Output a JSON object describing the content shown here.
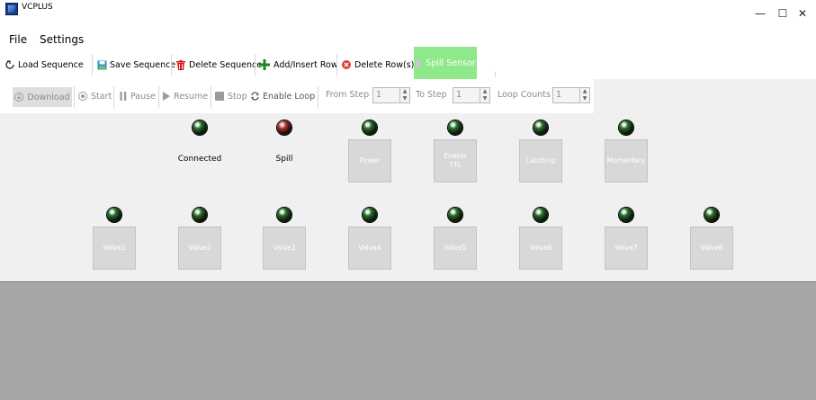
{
  "window": {
    "title": "VCPLUS"
  },
  "menu": {
    "file": "File",
    "settings": "Settings"
  },
  "toolbar": {
    "load": "Load Sequence",
    "save": "Save Sequence",
    "delete_seq": "Delete Sequence",
    "add_row": "Add/Insert Row",
    "delete_row": "Delete Row(s)",
    "spill_sensor": "Spill Sensor"
  },
  "controls": {
    "download": "Download",
    "start": "Start",
    "pause": "Pause",
    "resume": "Resume",
    "stop": "Stop",
    "enable_loop": "Enable Loop",
    "from_step_label": "From Step",
    "from_step_value": "1",
    "to_step_label": "To Step",
    "to_step_value": "1",
    "loop_counts_label": "Loop Counts",
    "loop_counts_value": "1"
  },
  "status": {
    "connected": "Connected",
    "spill": "Spill",
    "power": "Power",
    "enable_ttl_1": "Enable",
    "enable_ttl_2": "TTL",
    "latching": "Latching",
    "momentary": "Momentary"
  },
  "valves": [
    "Valve1",
    "Valve2",
    "Valve3",
    "Valve4",
    "Valve5",
    "Valve6",
    "Valve7",
    "Valve8"
  ],
  "colors": {
    "spill_sensor_bg": "#8fe88a",
    "bottom_panel": "#a6a6a6"
  }
}
